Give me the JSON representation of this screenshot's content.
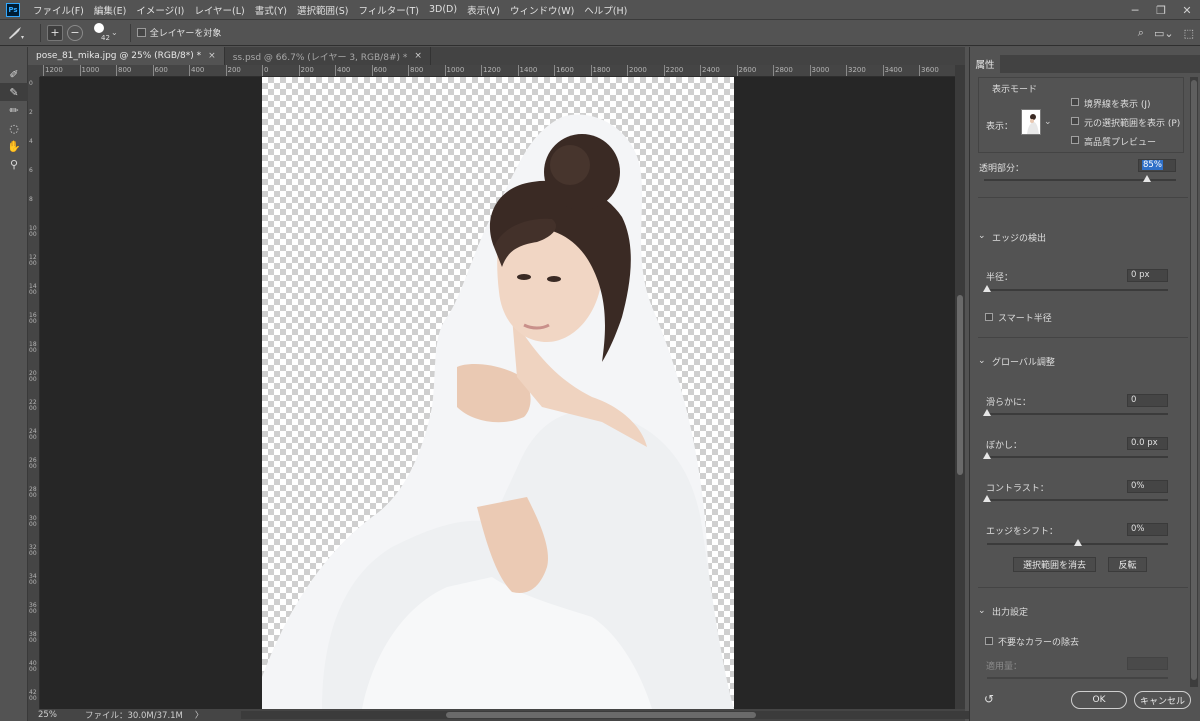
{
  "menu": {
    "logo": "Ps",
    "items": [
      "ファイル(F)",
      "編集(E)",
      "イメージ(I)",
      "レイヤー(L)",
      "書式(Y)",
      "選択範囲(S)",
      "フィルター(T)",
      "3D(D)",
      "表示(V)",
      "ウィンドウ(W)",
      "ヘルプ(H)"
    ]
  },
  "options": {
    "brush_size": "42",
    "sample_all_layers": "全レイヤーを対象"
  },
  "tabs": [
    {
      "label": "pose_81_mika.jpg @ 25% (RGB/8*) *",
      "close": "×"
    },
    {
      "label": "ss.psd @ 66.7% (レイヤー 3, RGB/8#) *",
      "close": "×"
    }
  ],
  "ruler": {
    "h_labels": [
      "1200",
      "1000",
      "800",
      "600",
      "400",
      "200",
      "0",
      "200",
      "400",
      "600",
      "800",
      "1000",
      "1200",
      "1400",
      "1600",
      "1800",
      "2000",
      "2200",
      "2400",
      "2600",
      "2800",
      "3000",
      "3200",
      "3400",
      "3600",
      "3800"
    ],
    "v_labels": [
      "0",
      "2",
      "4",
      "6",
      "8",
      "1000",
      "1200",
      "1400",
      "1600",
      "1800",
      "2000",
      "2200",
      "2400",
      "2600",
      "2800",
      "3000",
      "3200",
      "3400",
      "3600",
      "3800",
      "4000",
      "4200"
    ]
  },
  "status": {
    "zoom": "25%",
    "file": "ファイル：30.0M/37.1M",
    "arrow": "〉"
  },
  "panel": {
    "tab": "属性",
    "view_mode_title": "表示モード",
    "view_label": "表示：",
    "show_edge": "境界線を表示 (J)",
    "show_original": "元の選択範囲を表示 (P)",
    "high_quality": "高品質プレビュー",
    "transparency_label": "透明部分：",
    "transparency_value": "85%",
    "transparency": 0.85,
    "edge_detection_title": "エッジの検出",
    "radius_label": "半径：",
    "radius_value": "0 px",
    "radius": 0,
    "smart_radius": "スマート半径",
    "global_title": "グローバル調整",
    "smooth_label": "滑らかに：",
    "smooth_value": "0",
    "feather_label": "ぼかし：",
    "feather_value": "0.0 px",
    "contrast_label": "コントラスト：",
    "contrast_value": "0%",
    "shift_label": "エッジをシフト：",
    "shift_value": "0%",
    "shift_position": 0.5,
    "clear_selection": "選択範囲を消去",
    "invert": "反転",
    "output_title": "出力設定",
    "decontaminate": "不要なカラーの除去",
    "amount_label": "適用量：",
    "ok": "OK",
    "cancel": "キャンセル"
  }
}
